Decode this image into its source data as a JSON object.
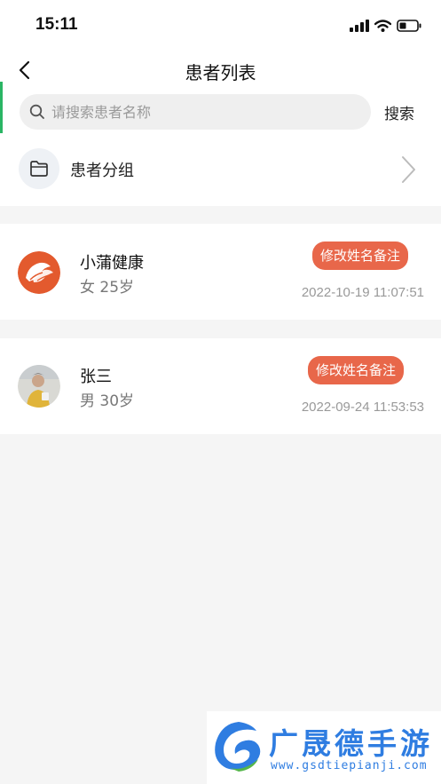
{
  "status_bar": {
    "time": "15:11"
  },
  "nav": {
    "title": "患者列表"
  },
  "search": {
    "placeholder": "请搜索患者名称",
    "value": "",
    "button_label": "搜索"
  },
  "group": {
    "label": "患者分组"
  },
  "patients": [
    {
      "name": "小蒲健康",
      "info": "女 25岁",
      "edit_label": "修改姓名备注",
      "time": "2022-10-19 11:07:51"
    },
    {
      "name": "张三",
      "info": "男 30岁",
      "edit_label": "修改姓名备注",
      "time": "2022-09-24 11:53:53"
    }
  ],
  "watermark": {
    "title": "广晟德手游",
    "url": "www.gsdtiepianji.com"
  },
  "colors": {
    "accent": "#e8674a",
    "background": "#f5f5f5",
    "watermark": "#2f7de1",
    "edge": "#2ab564"
  }
}
